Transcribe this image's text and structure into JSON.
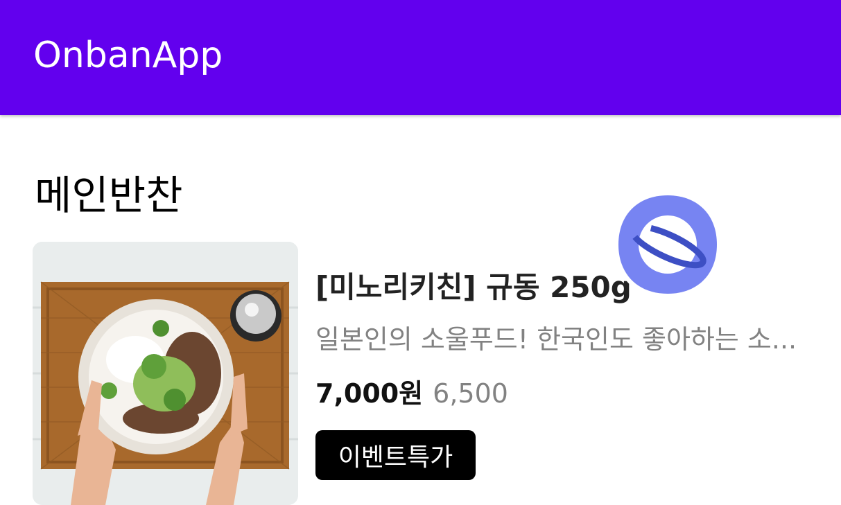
{
  "app_bar": {
    "title": "OnbanApp",
    "color": "#6200EE"
  },
  "section": {
    "title": "메인반찬"
  },
  "product": {
    "name": "[미노리키친] 규동 250g",
    "description": "일본인의 소울푸드! 한국인도 좋아하는 소...",
    "price": "7,000원",
    "sale_price": "6,500",
    "badge": "이벤트특가",
    "image": "gyudon-bowl-photo"
  },
  "overlay": {
    "icon": "samsung-internet-icon"
  }
}
